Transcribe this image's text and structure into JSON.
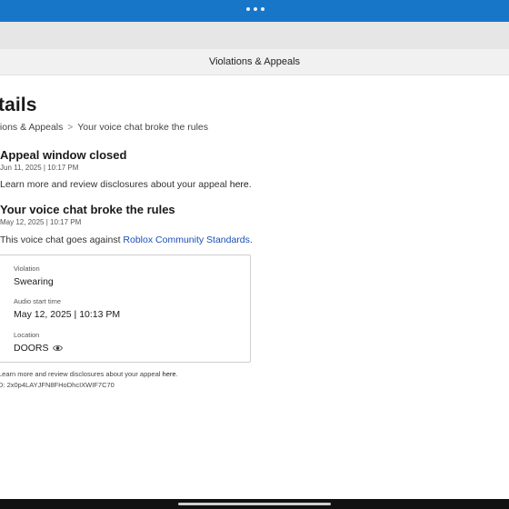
{
  "header": {
    "title": "Violations & Appeals"
  },
  "page": {
    "heading": "tails"
  },
  "breadcrumb": {
    "parent": "tions & Appeals",
    "separator": ">",
    "current": "Your voice chat broke the rules"
  },
  "appeal_section": {
    "title": "Appeal window closed",
    "date": "Jun 11, 2025 | 10:17 PM",
    "text_before_link": "Learn more and review disclosures about your appeal ",
    "link": "here",
    "text_after_link": "."
  },
  "violation_section": {
    "title": "Your voice chat broke the rules",
    "date": "May 12, 2025 | 10:17 PM",
    "text_before_link": "This voice chat goes against ",
    "link": "Roblox Community Standards",
    "text_after_link": "."
  },
  "details_card": {
    "violation_label": "Violation",
    "violation_value": "Swearing",
    "audio_label": "Audio start time",
    "audio_value": "May 12, 2025 | 10:13 PM",
    "location_label": "Location",
    "location_value": "DOORS",
    "location_icon": "eye-icon"
  },
  "footer": {
    "text_before_link": "Learn more and review disclosures about your appeal ",
    "link": "here",
    "text_after_link": ".",
    "id_text": "D: 2x0p4LAYJFN8FHoDhcIXWIF7C70"
  },
  "colors": {
    "status_bar": "#1876c9",
    "link": "#1a4fb5"
  }
}
